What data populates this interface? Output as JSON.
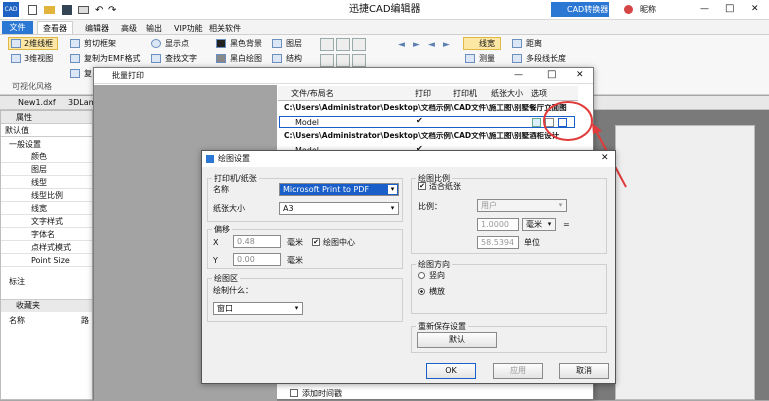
{
  "app": {
    "title": "迅捷CAD编辑器",
    "convert_btn": "CAD转换器",
    "user": "昵称",
    "min": "—",
    "max": "□",
    "close": "✕"
  },
  "menu": {
    "file": "文件",
    "tabs": [
      "查看器",
      "编辑器",
      "高级",
      "输出",
      "VIP功能",
      "相关软件"
    ]
  },
  "ribbon": {
    "col1": [
      "2维线框",
      "3维视图"
    ],
    "col2": [
      "剪切框架",
      "复制为EMF格式",
      "复"
    ],
    "col3": [
      "显示点",
      "查找文字"
    ],
    "col4": [
      "黑色背景",
      "黑白绘图"
    ],
    "col5": [
      "图层",
      "结构"
    ],
    "col7": [
      "线宽",
      "测量"
    ],
    "col8": [
      "距离",
      "多段线长度"
    ],
    "group_label": "可视化风格",
    "arrows": [
      "◄",
      "►",
      "◄",
      "►"
    ]
  },
  "doc_tabs": [
    "New1.dxf",
    "3DLam"
  ],
  "properties": {
    "title": "属性",
    "default": "默认值",
    "general": "一般设置",
    "items": [
      "颜色",
      "图层",
      "线型",
      "线型比例",
      "线宽",
      "文字样式",
      "字体名",
      "点样式模式",
      "Point Size"
    ],
    "annotation": "标注",
    "favorites": "收藏夹",
    "col_name": "名称",
    "col_path": "路"
  },
  "batch": {
    "title": "批量打印",
    "columns": [
      "文件/布局名",
      "打印",
      "打印机",
      "纸张大小",
      "选项"
    ],
    "rows": [
      {
        "type": "file",
        "text": "C:\\Users\\Administrator\\Desktop\\文档示例\\CAD文件\\施工图\\别墅餐厅立面图"
      },
      {
        "type": "layout",
        "text": "Model",
        "checked": "✔"
      },
      {
        "type": "file",
        "text": "C:\\Users\\Administrator\\Desktop\\文档示例\\CAD文件\\施工图\\别墅酒柜设计"
      },
      {
        "type": "layout",
        "text": "Model",
        "checked": "✔"
      }
    ],
    "footer_checkbox": "添加时间戳"
  },
  "dialog": {
    "title": "绘图设置",
    "printer_group": "打印机/纸张",
    "name_label": "名称",
    "printer": "Microsoft Print to PDF",
    "paper_label": "纸张大小",
    "paper": "A3",
    "offset_group": "偏移",
    "x_label": "X",
    "x_value": "0.48",
    "y_label": "Y",
    "y_value": "0.00",
    "unit": "毫米",
    "center_plot": "绘图中心",
    "area_group": "绘图区",
    "what_label": "绘制什么：",
    "what": "窗口",
    "scale_group": "绘图比例",
    "fit_paper": "适合纸张",
    "scale_label": "比例：",
    "scale_value": "用户",
    "scale1": "1.0000",
    "scale_unit": "毫米",
    "eq": "=",
    "scale2": "58.5394",
    "unit_label": "单位",
    "orient_group": "绘图方向",
    "portrait": "竖向",
    "landscape": "横放",
    "reset_group": "重新保存设置",
    "default_btn": "默认",
    "ok": "OK",
    "apply": "应用",
    "cancel": "取消",
    "close": "✕"
  },
  "accent": "#2b78d4",
  "annotation_color": "#e23b3b"
}
